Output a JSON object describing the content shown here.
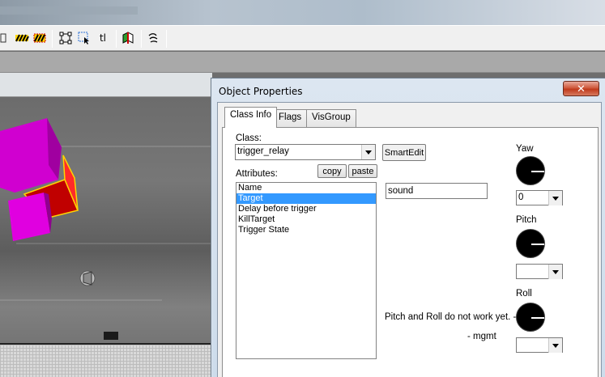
{
  "toolbar": {
    "icons": [
      "hatch-icon",
      "hatch-box-icon",
      "select-box-icon",
      "select-area-icon",
      "texture-lock-icon",
      "carve-icon",
      "hand-icon"
    ],
    "text_button": "tl"
  },
  "dialog": {
    "title": "Object Properties",
    "close_label": "✕",
    "tabs": [
      "Class Info",
      "Flags",
      "VisGroup"
    ],
    "class_label": "Class:",
    "class_value": "trigger_relay",
    "smartedit_label": "SmartEdit",
    "attributes_label": "Attributes:",
    "copy_label": "copy",
    "paste_label": "paste",
    "attributes": [
      "Name",
      "Target",
      "Delay before trigger",
      "KillTarget",
      "Trigger State"
    ],
    "selected_attribute": "Target",
    "value_field": "sound",
    "yaw_label": "Yaw",
    "yaw_value": "0",
    "pitch_label": "Pitch",
    "pitch_value": "",
    "roll_label": "Roll",
    "roll_value": "",
    "note": "Pitch and Roll do not work yet. ->",
    "signature": "- mgmt"
  },
  "colors": {
    "magenta": "#e000e0",
    "red": "#c00000",
    "selection": "#3399ff"
  }
}
